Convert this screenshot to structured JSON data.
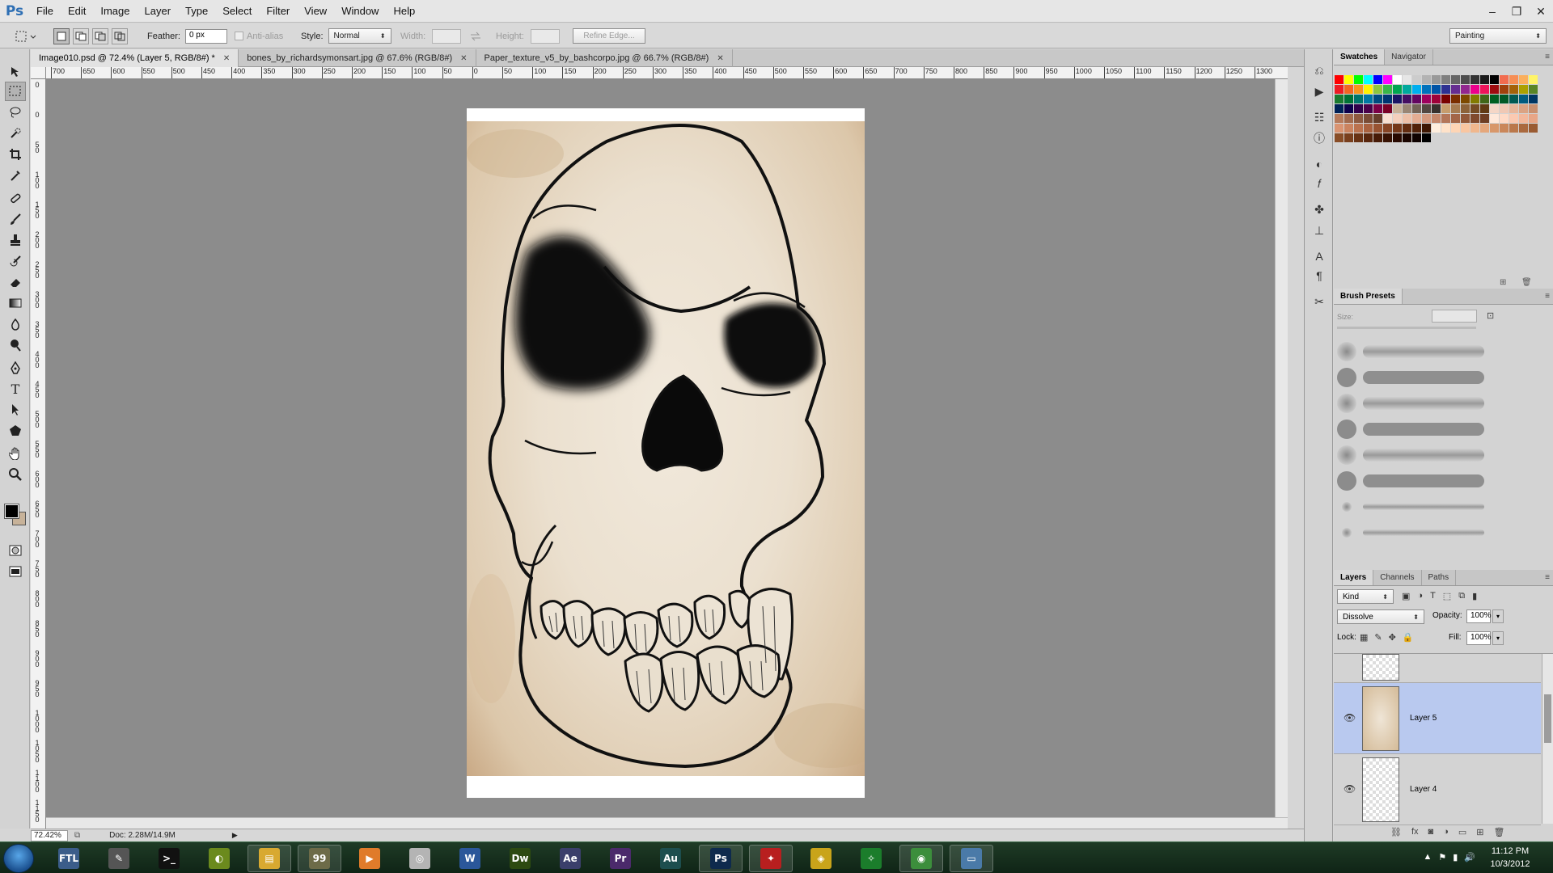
{
  "app": {
    "logo": "Ps"
  },
  "menu": [
    "File",
    "Edit",
    "Image",
    "Layer",
    "Type",
    "Select",
    "Filter",
    "View",
    "Window",
    "Help"
  ],
  "window_controls": [
    "–",
    "❐",
    "✕"
  ],
  "options": {
    "feather_label": "Feather:",
    "feather_value": "0 px",
    "antialias_label": "Anti-alias",
    "style_label": "Style:",
    "style_value": "Normal",
    "width_label": "Width:",
    "height_label": "Height:",
    "refine_edge": "Refine Edge...",
    "workspace": "Painting"
  },
  "doc_tabs": [
    {
      "label": "Image010.psd @ 72.4% (Layer 5, RGB/8#) *",
      "active": true
    },
    {
      "label": "bones_by_richardsymonsart.jpg @ 67.6% (RGB/8#)",
      "active": false
    },
    {
      "label": "Paper_texture_v5_by_bashcorpo.jpg @ 66.7% (RGB/8#)",
      "active": false
    }
  ],
  "ruler_h": [
    "700",
    "650",
    "600",
    "550",
    "500",
    "450",
    "400",
    "350",
    "300",
    "250",
    "200",
    "150",
    "100",
    "50",
    "0",
    "50",
    "100",
    "150",
    "200",
    "250",
    "300",
    "350",
    "400",
    "450",
    "500",
    "550",
    "600",
    "650",
    "700",
    "750",
    "800",
    "850",
    "900",
    "950",
    "1000",
    "1050",
    "1100",
    "1150",
    "1200",
    "1250",
    "1300"
  ],
  "ruler_v": [
    "0",
    "0",
    "50",
    "100",
    "150",
    "200",
    "250",
    "300",
    "350",
    "400",
    "450",
    "500",
    "550",
    "600",
    "650",
    "700",
    "750",
    "800",
    "850",
    "900",
    "950",
    "1000",
    "1050",
    "1100",
    "1150",
    "1200"
  ],
  "status": {
    "zoom": "72.42%",
    "doc": "Doc: 2.28M/14.9M"
  },
  "swatches_panel": {
    "tabs": [
      "Swatches",
      "Navigator"
    ]
  },
  "swatch_colors": [
    "#ff0000",
    "#ffff00",
    "#00ff00",
    "#00ffff",
    "#0000ff",
    "#ff00ff",
    "#ffffff",
    "#e6e6e6",
    "#cccccc",
    "#b3b3b3",
    "#999999",
    "#808080",
    "#666666",
    "#4d4d4d",
    "#333333",
    "#1a1a1a",
    "#000000",
    "#f26c4f",
    "#f68e55",
    "#fbaf5d",
    "#fff467",
    "#ed1c24",
    "#f26522",
    "#f7941d",
    "#fff200",
    "#8dc63f",
    "#39b54a",
    "#00a651",
    "#00a99d",
    "#00aeef",
    "#0072bc",
    "#0054a6",
    "#2e3192",
    "#662d91",
    "#92278f",
    "#ec008c",
    "#ed145b",
    "#9e0b0f",
    "#a0410d",
    "#a3620a",
    "#aba000",
    "#598527",
    "#1a7b30",
    "#007236",
    "#00746b",
    "#0076a3",
    "#004b80",
    "#003471",
    "#1b1464",
    "#440e62",
    "#630460",
    "#9e005d",
    "#9e0039",
    "#790000",
    "#7b2e00",
    "#7d4900",
    "#827b00",
    "#406618",
    "#005e20",
    "#005826",
    "#005952",
    "#005b7f",
    "#003663",
    "#002157",
    "#0d004c",
    "#32004b",
    "#4b0049",
    "#7b0046",
    "#7a0026",
    "#c7b299",
    "#998675",
    "#736357",
    "#534741",
    "#37302d",
    "#c69c6d",
    "#a67c52",
    "#8c6239",
    "#754c24",
    "#603913",
    "#f5d6c6",
    "#f0c8b4",
    "#e8b69a",
    "#dba383",
    "#c9906f",
    "#b67a5b",
    "#a26a4d",
    "#8e5a40",
    "#7a4c35",
    "#663f2b",
    "#f9e0d2",
    "#f4d0bd",
    "#edc0a8",
    "#e3ad93",
    "#d59a7f",
    "#c5876b",
    "#b47659",
    "#a36648",
    "#925839",
    "#804a2d",
    "#6e3d22",
    "#ffe8da",
    "#ffdac6",
    "#fbc9b1",
    "#f3b89c",
    "#e8a687",
    "#da9472",
    "#cb835f",
    "#bb724e",
    "#aa623f",
    "#985331",
    "#874525",
    "#753819",
    "#632c10",
    "#512108",
    "#3e1702",
    "#ffeedd",
    "#ffe2c9",
    "#fed5b5",
    "#f9c6a1",
    "#f0b78d",
    "#e5a77b",
    "#d8976a",
    "#ca875a",
    "#ba784b",
    "#aa693e",
    "#9a5b32",
    "#894d27",
    "#793f1d",
    "#683214",
    "#58260d",
    "#471b07",
    "#371203",
    "#280a01",
    "#1a0500",
    "#0f0200",
    "#000000"
  ],
  "brush_panel": {
    "title": "Brush Presets",
    "size_label": "Size:"
  },
  "brushes": [
    {
      "soft": true
    },
    {
      "soft": false
    },
    {
      "soft": true
    },
    {
      "soft": false
    },
    {
      "soft": true
    },
    {
      "soft": false
    },
    {
      "soft": true
    },
    {
      "soft": true
    }
  ],
  "layers_panel": {
    "tabs": [
      "Layers",
      "Channels",
      "Paths"
    ],
    "filter": "Kind",
    "blend_mode": "Dissolve",
    "opacity_label": "Opacity:",
    "opacity": "100%",
    "lock_label": "Lock:",
    "fill_label": "Fill:",
    "fill": "100%",
    "layers": [
      {
        "name": "Layer 5",
        "selected": true,
        "visible": true
      },
      {
        "name": "Layer 4",
        "selected": false,
        "visible": true
      }
    ]
  },
  "taskbar": {
    "apps": [
      {
        "name": "FTL",
        "label": "FTL",
        "color": "#3b5d8a"
      },
      {
        "name": "Pen tool",
        "label": "✎",
        "color": "#555"
      },
      {
        "name": "Terminal",
        "label": ">_",
        "color": "#111"
      },
      {
        "name": "Media player",
        "label": "◐",
        "color": "#6b8a1d"
      },
      {
        "name": "File explorer",
        "label": "▤",
        "color": "#d8a930"
      },
      {
        "name": "Game",
        "label": "99",
        "color": "#6d6b48"
      },
      {
        "name": "Video player",
        "label": "▶",
        "color": "#e07b2a"
      },
      {
        "name": "Browser",
        "label": "◎",
        "color": "#b4b4b4"
      },
      {
        "name": "Word",
        "label": "W",
        "color": "#2b579a"
      },
      {
        "name": "Dreamweaver",
        "label": "Dw",
        "color": "#2d4a11"
      },
      {
        "name": "After Effects",
        "label": "Ae",
        "color": "#3b3f6b"
      },
      {
        "name": "Premiere",
        "label": "Pr",
        "color": "#4b2a6b"
      },
      {
        "name": "Audition",
        "label": "Au",
        "color": "#1d4e4e"
      },
      {
        "name": "Photoshop",
        "label": "Ps",
        "color": "#0e2a4d"
      },
      {
        "name": "Red app",
        "label": "✦",
        "color": "#b81f1f"
      },
      {
        "name": "Yellow app",
        "label": "◈",
        "color": "#c9a41a"
      },
      {
        "name": "Razer",
        "label": "✧",
        "color": "#1b7d2b"
      },
      {
        "name": "Chrome",
        "label": "◉",
        "color": "#3c8e3c"
      },
      {
        "name": "Window app",
        "label": "▭",
        "color": "#4a7aa8"
      }
    ],
    "time": "11:12 PM",
    "date": "10/3/2012"
  }
}
